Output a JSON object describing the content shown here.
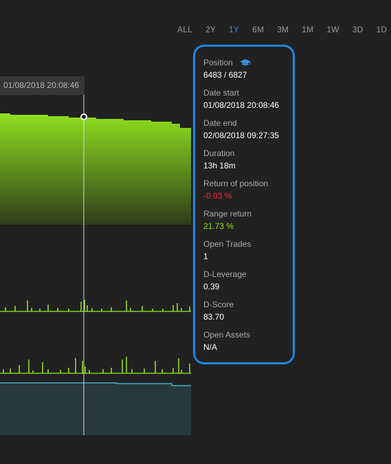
{
  "ranges": {
    "items": [
      "ALL",
      "2Y",
      "1Y",
      "6M",
      "3M",
      "1M",
      "1W",
      "3D",
      "1D"
    ],
    "active": "1Y"
  },
  "cursor": {
    "date_label": "01/08/2018 20:08:46"
  },
  "panel": {
    "position": {
      "label": "Position",
      "value": "6483 / 6827",
      "icon": "graduation-cap-icon"
    },
    "date_start": {
      "label": "Date start",
      "value": "01/08/2018 20:08:46"
    },
    "date_end": {
      "label": "Date end",
      "value": "02/08/2018 09:27:35"
    },
    "duration": {
      "label": "Duration",
      "value": "13h 18m"
    },
    "return_of_position": {
      "label": "Return of position",
      "value": "-0.03 %"
    },
    "range_return": {
      "label": "Range return",
      "value": "21.73 %"
    },
    "open_trades": {
      "label": "Open Trades",
      "value": "1"
    },
    "d_leverage": {
      "label": "D-Leverage",
      "value": "0.39"
    },
    "d_score": {
      "label": "D-Score",
      "value": "83.70"
    },
    "open_assets": {
      "label": "Open Assets",
      "value": "N/A"
    }
  },
  "colors": {
    "accent": "#1e88e5",
    "active_range": "#3d8fe0",
    "negative": "#ff2b2b",
    "positive": "#8de51d",
    "area_top": "#8fe01f",
    "area_bottom": "#2e3d1a",
    "spike": "#9be52a",
    "teal_fill": "#27393e",
    "teal_line": "#3aaebe"
  }
}
